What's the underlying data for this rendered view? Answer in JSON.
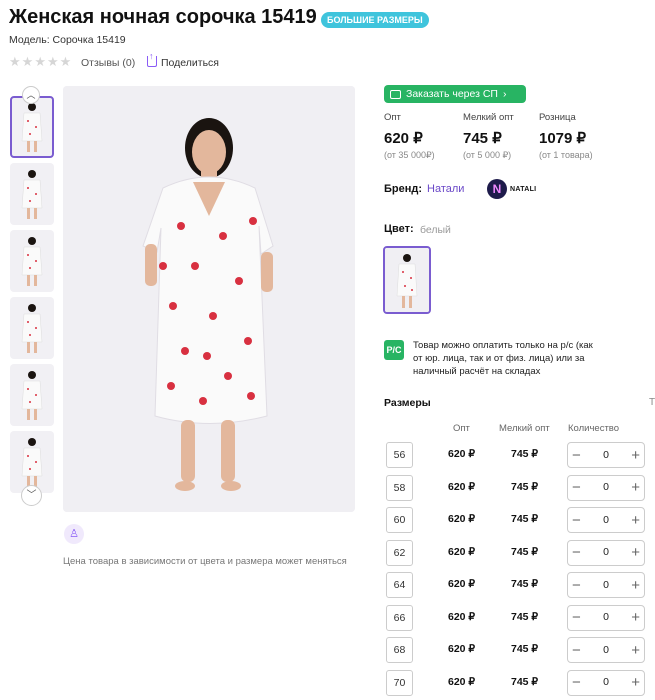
{
  "product": {
    "title": "Женская ночная сорочка 15419",
    "badge": "БОЛЬШИЕ РАЗМЕРЫ",
    "model": "Модель: Сорочка 15419",
    "rating_stars": 0,
    "reviews": "Отзывы (0)",
    "share": "Поделиться"
  },
  "gallery": {
    "price_note": "Цена товара в зависимости от цвета и размера может меняться",
    "thumbnails_count": 6
  },
  "order": {
    "sp_button": "Заказать через СП"
  },
  "prices": [
    {
      "label": "Опт",
      "value": "620 ₽",
      "sub": "(от 35 000₽)"
    },
    {
      "label": "Мелкий опт",
      "value": "745 ₽",
      "sub": "(от 5 000 ₽)"
    },
    {
      "label": "Розница",
      "value": "1079 ₽",
      "sub": "(от 1 товара)"
    }
  ],
  "brand": {
    "label": "Бренд:",
    "value": "Натали",
    "logo_text": "NATALI"
  },
  "color": {
    "label": "Цвет:",
    "value": "белый"
  },
  "payment": {
    "icon_text": "Р/С",
    "text": "Товар можно оплатить только на р/с (как от юр. лица, так и от физ. лица) или за наличный расчёт на складах"
  },
  "sizes": {
    "heading": "Размеры",
    "more": "Т",
    "col_opt": "Опт",
    "col_small": "Мелкий опт",
    "col_qty": "Количество",
    "rows": [
      {
        "size": "56",
        "opt": "620 ₽",
        "small": "745 ₽",
        "qty": "0"
      },
      {
        "size": "58",
        "opt": "620 ₽",
        "small": "745 ₽",
        "qty": "0"
      },
      {
        "size": "60",
        "opt": "620 ₽",
        "small": "745 ₽",
        "qty": "0"
      },
      {
        "size": "62",
        "opt": "620 ₽",
        "small": "745 ₽",
        "qty": "0"
      },
      {
        "size": "64",
        "opt": "620 ₽",
        "small": "745 ₽",
        "qty": "0"
      },
      {
        "size": "66",
        "opt": "620 ₽",
        "small": "745 ₽",
        "qty": "0"
      },
      {
        "size": "68",
        "opt": "620 ₽",
        "small": "745 ₽",
        "qty": "0"
      },
      {
        "size": "70",
        "opt": "620 ₽",
        "small": "745 ₽",
        "qty": "0"
      }
    ]
  },
  "colors": {
    "accent": "#7a5cd0",
    "badge": "#3fc4dc",
    "green": "#28b463"
  }
}
